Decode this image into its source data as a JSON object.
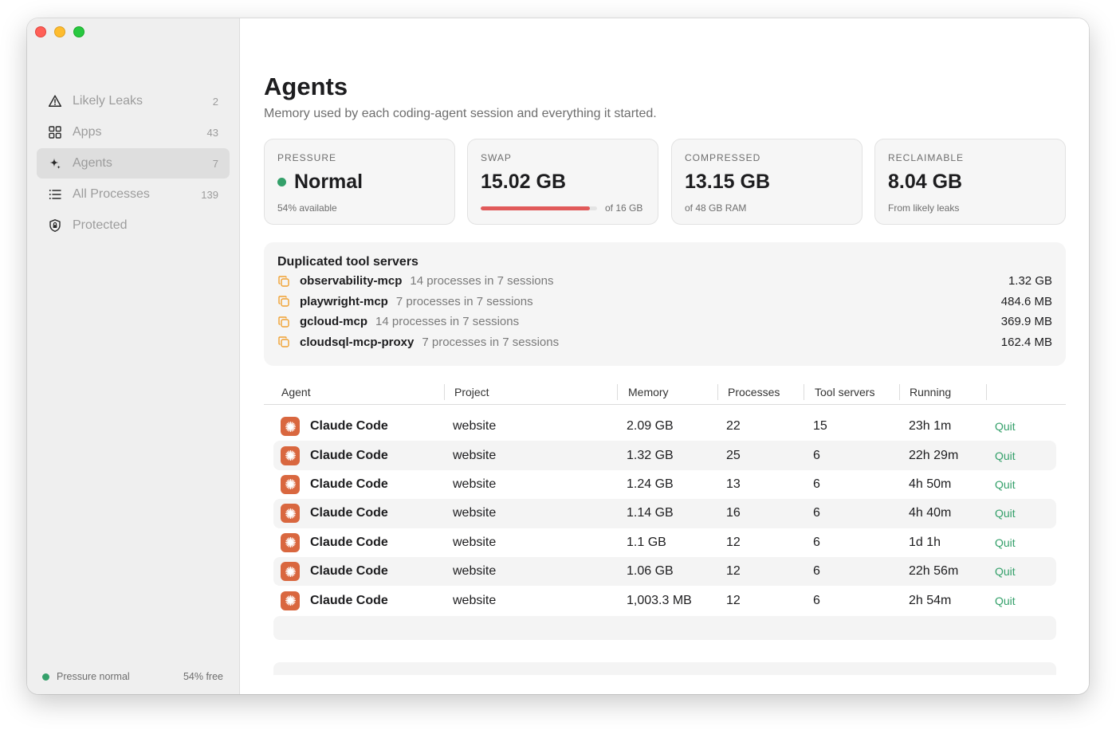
{
  "sidebar": {
    "items": [
      {
        "label": "Likely Leaks",
        "count": "2",
        "icon": "warning-icon"
      },
      {
        "label": "Apps",
        "count": "43",
        "icon": "grid-icon"
      },
      {
        "label": "Agents",
        "count": "7",
        "icon": "sparkle-icon",
        "active": true
      },
      {
        "label": "All Processes",
        "count": "139",
        "icon": "list-icon"
      },
      {
        "label": "Protected",
        "count": "",
        "icon": "shield-icon"
      }
    ],
    "footer": {
      "status": "Pressure normal",
      "free": "54% free",
      "status_color": "#34a06a"
    }
  },
  "main": {
    "title": "Agents",
    "subtitle": "Memory used by each coding-agent session and everything it started."
  },
  "cards": {
    "pressure": {
      "caption": "PRESSURE",
      "value": "Normal",
      "sub": "54% available",
      "dot_color": "#34a06a"
    },
    "swap": {
      "caption": "SWAP",
      "value": "15.02 GB",
      "sub": "of 16 GB",
      "fill_fraction": 0.94,
      "fill_color": "#e15a5a"
    },
    "compressed": {
      "caption": "COMPRESSED",
      "value": "13.15 GB",
      "sub": "of 48 GB RAM"
    },
    "reclaimable": {
      "caption": "RECLAIMABLE",
      "value": "8.04 GB",
      "sub": "From likely leaks"
    }
  },
  "duplicated": {
    "title": "Duplicated tool servers",
    "items": [
      {
        "name": "observability-mcp",
        "desc": "14 processes in 7 sessions",
        "size": "1.32 GB"
      },
      {
        "name": "playwright-mcp",
        "desc": "7 processes in 7 sessions",
        "size": "484.6 MB"
      },
      {
        "name": "gcloud-mcp",
        "desc": "14 processes in 7 sessions",
        "size": "369.9 MB"
      },
      {
        "name": "cloudsql-mcp-proxy",
        "desc": "7 processes in 7 sessions",
        "size": "162.4 MB"
      }
    ],
    "icon_color": "#f0a030"
  },
  "table": {
    "headers": {
      "agent": "Agent",
      "project": "Project",
      "memory": "Memory",
      "processes": "Processes",
      "tool_servers": "Tool servers",
      "running": "Running"
    },
    "rows": [
      {
        "agent": "Claude Code",
        "project": "website",
        "memory": "2.09 GB",
        "processes": "22",
        "tool_servers": "15",
        "running": "23h 1m",
        "action": "Quit"
      },
      {
        "agent": "Claude Code",
        "project": "website",
        "memory": "1.32 GB",
        "processes": "25",
        "tool_servers": "6",
        "running": "22h 29m",
        "action": "Quit"
      },
      {
        "agent": "Claude Code",
        "project": "website",
        "memory": "1.24 GB",
        "processes": "13",
        "tool_servers": "6",
        "running": "4h 50m",
        "action": "Quit"
      },
      {
        "agent": "Claude Code",
        "project": "website",
        "memory": "1.14 GB",
        "processes": "16",
        "tool_servers": "6",
        "running": "4h 40m",
        "action": "Quit"
      },
      {
        "agent": "Claude Code",
        "project": "website",
        "memory": "1.1 GB",
        "processes": "12",
        "tool_servers": "6",
        "running": "1d 1h",
        "action": "Quit"
      },
      {
        "agent": "Claude Code",
        "project": "website",
        "memory": "1.06 GB",
        "processes": "12",
        "tool_servers": "6",
        "running": "22h 56m",
        "action": "Quit"
      },
      {
        "agent": "Claude Code",
        "project": "website",
        "memory": "1,003.3 MB",
        "processes": "12",
        "tool_servers": "6",
        "running": "2h 54m",
        "action": "Quit"
      }
    ],
    "agent_icon": "claude-logo-icon",
    "agent_icon_color": "#d9673f",
    "quit_color": "#34a06a"
  }
}
